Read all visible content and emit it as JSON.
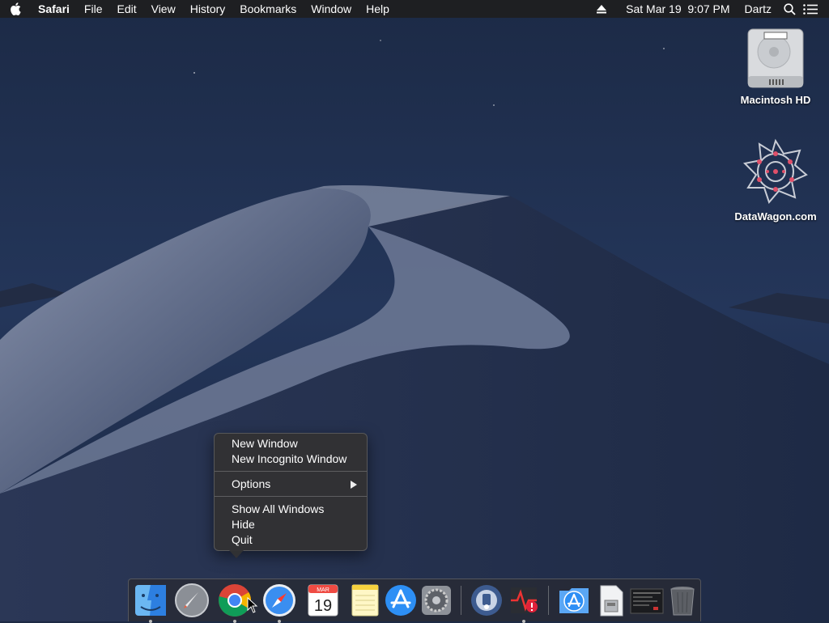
{
  "menubar": {
    "apple_icon": "apple-logo-icon",
    "app_name": "Safari",
    "menus": [
      "File",
      "Edit",
      "View",
      "History",
      "Bookmarks",
      "Window",
      "Help"
    ],
    "status": {
      "eject_icon": "eject-icon",
      "datetime": "Sat Mar 19  9:07 PM",
      "user": "Dartz",
      "search_icon": "spotlight-search-icon",
      "list_icon": "notification-center-icon"
    }
  },
  "desktop": {
    "icons": [
      {
        "label": "Macintosh HD",
        "icon": "hard-drive-icon"
      },
      {
        "label": "DataWagon.com",
        "icon": "datawagon-app-icon"
      }
    ]
  },
  "context_menu": {
    "items": [
      {
        "label": "New Window"
      },
      {
        "label": "New Incognito Window"
      },
      {
        "label": "Options",
        "submenu": true
      },
      {
        "label": "Show All Windows"
      },
      {
        "label": "Hide"
      },
      {
        "label": "Quit"
      }
    ]
  },
  "dock": {
    "apps": [
      {
        "name": "Finder",
        "icon": "finder-icon",
        "running": true
      },
      {
        "name": "Launchpad",
        "icon": "launchpad-icon",
        "running": false
      },
      {
        "name": "Google Chrome",
        "icon": "chrome-icon",
        "running": true
      },
      {
        "name": "Safari",
        "icon": "safari-icon",
        "running": true
      },
      {
        "name": "Calendar",
        "icon": "calendar-icon",
        "running": false,
        "month": "MAR",
        "day": "19"
      },
      {
        "name": "Notes",
        "icon": "notes-icon",
        "running": false
      },
      {
        "name": "App Store",
        "icon": "app-store-icon",
        "running": false
      },
      {
        "name": "System Preferences",
        "icon": "system-preferences-icon",
        "running": false
      },
      {
        "name": "Utility",
        "icon": "utility-app-icon",
        "running": false
      },
      {
        "name": "Diagnostics",
        "icon": "diagnostics-app-icon",
        "running": true
      },
      {
        "name": "Applications",
        "icon": "applications-folder-icon",
        "running": false
      },
      {
        "name": "Document",
        "icon": "document-icon",
        "running": false
      },
      {
        "name": "Screenshot",
        "icon": "screenshot-thumbnail-icon",
        "running": false
      },
      {
        "name": "Trash",
        "icon": "trash-icon",
        "running": false
      }
    ]
  }
}
